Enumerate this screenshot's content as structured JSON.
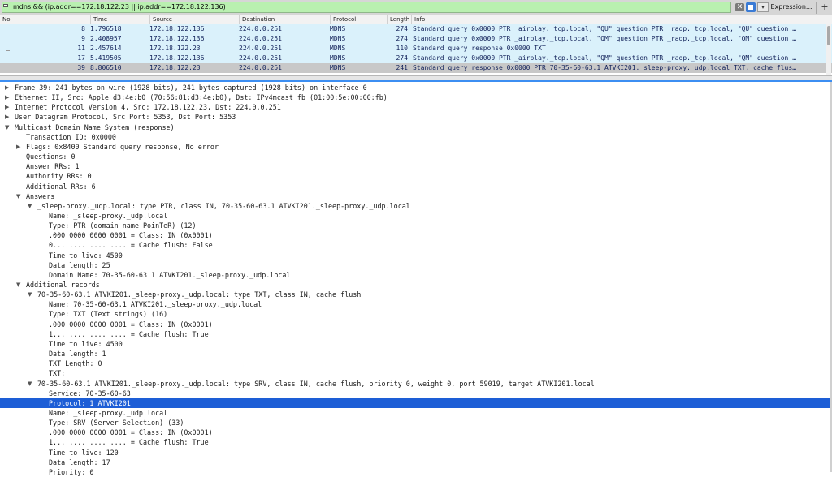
{
  "filter": {
    "value": "mdns && (ip.addr==172.18.122.23  ||  ip.addr==172.18.122.136)",
    "clear_glyph": "✕",
    "dropdown_glyph": "▾",
    "expression_label": "Expression...",
    "add_glyph": "+",
    "accent_color": "#b9f0b0"
  },
  "packet_list": {
    "columns": [
      "No.",
      "Time",
      "Source",
      "Destination",
      "Protocol",
      "Length",
      "Info"
    ],
    "rows": [
      {
        "no": "8",
        "time": "1.796518",
        "source": "172.18.122.136",
        "destination": "224.0.0.251",
        "protocol": "MDNS",
        "length": "274",
        "info": "Standard query 0x0000 PTR _airplay._tcp.local, \"QU\" question PTR _raop._tcp.local, \"QU\" question …"
      },
      {
        "no": "9",
        "time": "2.408957",
        "source": "172.18.122.136",
        "destination": "224.0.0.251",
        "protocol": "MDNS",
        "length": "274",
        "info": "Standard query 0x0000 PTR _airplay._tcp.local, \"QM\" question PTR _raop._tcp.local, \"QM\" question …"
      },
      {
        "no": "11",
        "time": "2.457614",
        "source": "172.18.122.23",
        "destination": "224.0.0.251",
        "protocol": "MDNS",
        "length": "110",
        "info": "Standard query response 0x0000 TXT"
      },
      {
        "no": "17",
        "time": "5.419505",
        "source": "172.18.122.136",
        "destination": "224.0.0.251",
        "protocol": "MDNS",
        "length": "274",
        "info": "Standard query 0x0000 PTR _airplay._tcp.local, \"QM\" question PTR _raop._tcp.local, \"QM\" question …"
      },
      {
        "no": "39",
        "time": "8.806510",
        "source": "172.18.122.23",
        "destination": "224.0.0.251",
        "protocol": "MDNS",
        "length": "241",
        "info": "Standard query response 0x0000 PTR 70-35-60-63.1 ATVKI201._sleep-proxy._udp.local TXT, cache flus…"
      }
    ],
    "row_color": "#daf1fb",
    "selected_row_color": "#c8c8c8"
  },
  "details": [
    {
      "text": "Frame 39: 241 bytes on wire (1928 bits), 241 bytes captured (1928 bits) on interface 0",
      "twisty": "▶"
    },
    {
      "text": "Ethernet II, Src: Apple_d3:4e:b0 (70:56:81:d3:4e:b0), Dst: IPv4mcast_fb (01:00:5e:00:00:fb)",
      "twisty": "▶"
    },
    {
      "text": "Internet Protocol Version 4, Src: 172.18.122.23, Dst: 224.0.0.251",
      "twisty": "▶"
    },
    {
      "text": "User Datagram Protocol, Src Port: 5353, Dst Port: 5353",
      "twisty": "▶"
    },
    {
      "text": "Multicast Domain Name System (response)",
      "twisty": "▼"
    },
    {
      "text": "Transaction ID: 0x0000",
      "twisty": ""
    },
    {
      "text": "Flags: 0x8400 Standard query response, No error",
      "twisty": "▶"
    },
    {
      "text": "Questions: 0",
      "twisty": ""
    },
    {
      "text": "Answer RRs: 1",
      "twisty": ""
    },
    {
      "text": "Authority RRs: 0",
      "twisty": ""
    },
    {
      "text": "Additional RRs: 6",
      "twisty": ""
    },
    {
      "text": "Answers",
      "twisty": "▼"
    },
    {
      "text": "_sleep-proxy._udp.local: type PTR, class IN, 70-35-60-63.1 ATVKI201._sleep-proxy._udp.local",
      "twisty": "▼"
    },
    {
      "text": "Name: _sleep-proxy._udp.local",
      "twisty": ""
    },
    {
      "text": "Type: PTR (domain name PoinTeR) (12)",
      "twisty": ""
    },
    {
      "text": ".000 0000 0000 0001 = Class: IN (0x0001)",
      "twisty": ""
    },
    {
      "text": "0... .... .... .... = Cache flush: False",
      "twisty": ""
    },
    {
      "text": "Time to live: 4500",
      "twisty": ""
    },
    {
      "text": "Data length: 25",
      "twisty": ""
    },
    {
      "text": "Domain Name: 70-35-60-63.1 ATVKI201._sleep-proxy._udp.local",
      "twisty": ""
    },
    {
      "text": "Additional records",
      "twisty": "▼"
    },
    {
      "text": "70-35-60-63.1 ATVKI201._sleep-proxy._udp.local: type TXT, class IN, cache flush",
      "twisty": "▼"
    },
    {
      "text": "Name: 70-35-60-63.1 ATVKI201._sleep-proxy._udp.local",
      "twisty": ""
    },
    {
      "text": "Type: TXT (Text strings) (16)",
      "twisty": ""
    },
    {
      "text": ".000 0000 0000 0001 = Class: IN (0x0001)",
      "twisty": ""
    },
    {
      "text": "1... .... .... .... = Cache flush: True",
      "twisty": ""
    },
    {
      "text": "Time to live: 4500",
      "twisty": ""
    },
    {
      "text": "Data length: 1",
      "twisty": ""
    },
    {
      "text": "TXT Length: 0",
      "twisty": ""
    },
    {
      "text": "TXT:",
      "twisty": ""
    },
    {
      "text": "70-35-60-63.1 ATVKI201._sleep-proxy._udp.local: type SRV, class IN, cache flush, priority 0, weight 0, port 59019, target ATVKI201.local",
      "twisty": "▼"
    },
    {
      "text": "Service: 70-35-60-63",
      "twisty": ""
    },
    {
      "text": "Protocol: 1 ATVKI201",
      "twisty": ""
    },
    {
      "text": "Name: _sleep-proxy._udp.local",
      "twisty": ""
    },
    {
      "text": "Type: SRV (Server Selection) (33)",
      "twisty": ""
    },
    {
      "text": ".000 0000 0000 0001 = Class: IN (0x0001)",
      "twisty": ""
    },
    {
      "text": "1... .... .... .... = Cache flush: True",
      "twisty": ""
    },
    {
      "text": "Time to live: 120",
      "twisty": ""
    },
    {
      "text": "Data length: 17",
      "twisty": ""
    },
    {
      "text": "Priority: 0",
      "twisty": ""
    }
  ],
  "detail_selected_color": "#1d5ed6"
}
